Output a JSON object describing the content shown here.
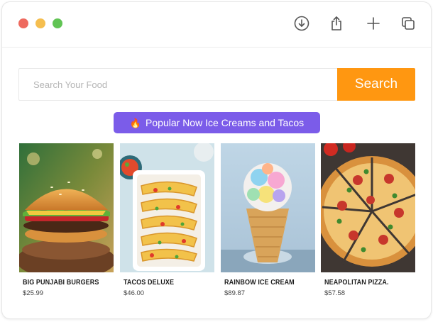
{
  "window": {
    "traffic_lights": [
      {
        "name": "close",
        "color": "#ee6a5f"
      },
      {
        "name": "minimize",
        "color": "#f5be4f"
      },
      {
        "name": "zoom",
        "color": "#61c454"
      }
    ],
    "toolbar_icons": [
      "download-icon",
      "share-icon",
      "plus-icon",
      "copy-icon"
    ]
  },
  "search": {
    "placeholder": "Search Your Food",
    "value": "",
    "button_label": "Search",
    "button_color": "#ff9711"
  },
  "banner": {
    "icon": "fire-icon",
    "text": "Popular Now Ice Creams and Tacos",
    "color": "#7b5ce9"
  },
  "products": [
    {
      "name": "BIG PUNJABI BURGERS",
      "price": "$25.99",
      "image": "burger-image"
    },
    {
      "name": "TACOS DELUXE",
      "price": "$46.00",
      "image": "tacos-image"
    },
    {
      "name": "RAINBOW ICE CREAM",
      "price": "$89.87",
      "image": "ice-cream-image"
    },
    {
      "name": "NEAPOLITAN PIZZA.",
      "price": "$57.58",
      "image": "pizza-image"
    }
  ]
}
